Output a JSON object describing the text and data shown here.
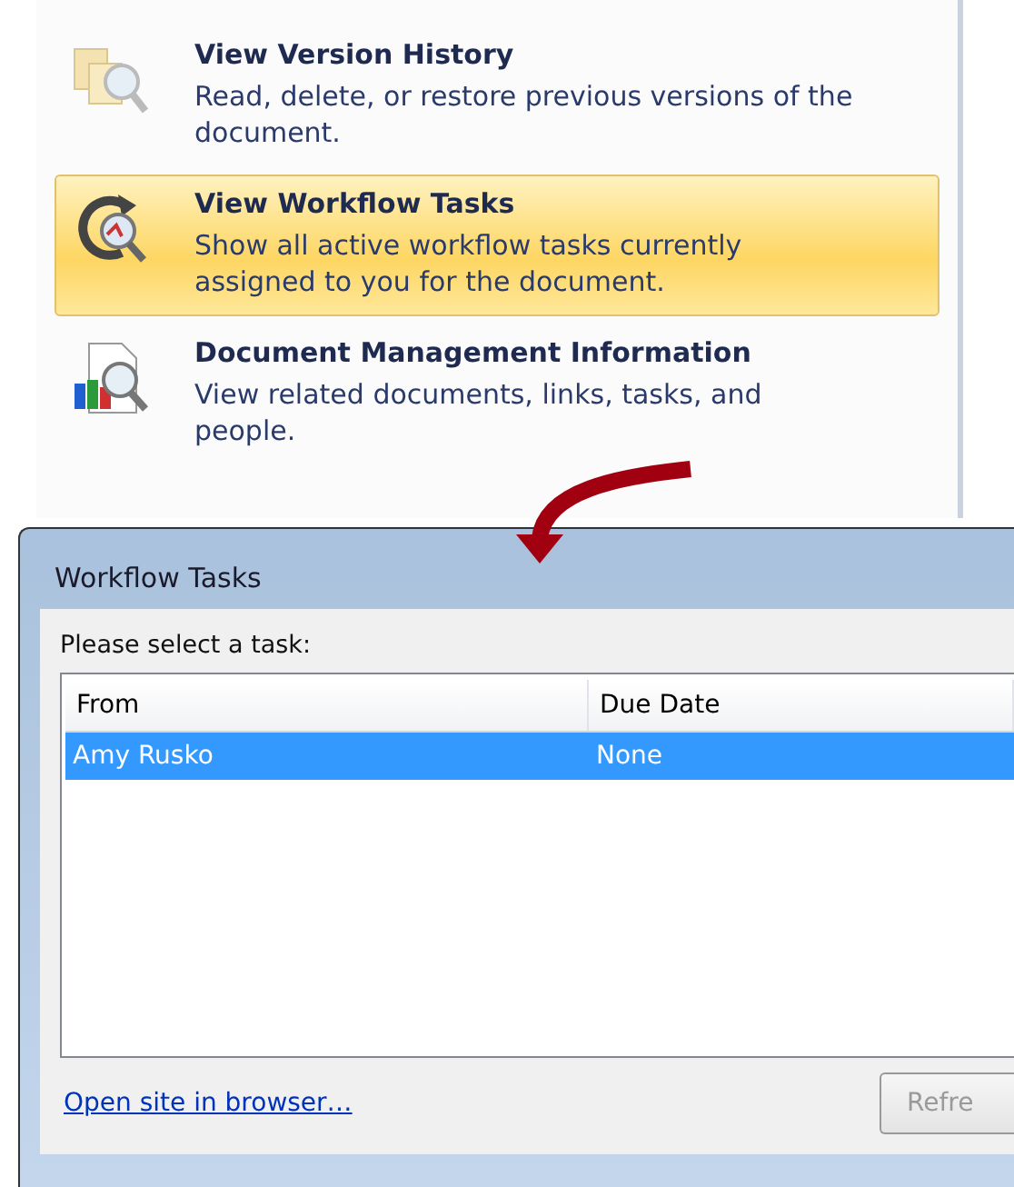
{
  "menu": {
    "items": [
      {
        "kind": "history",
        "title": "View Version History",
        "description": "Read, delete, or restore previous versions of the document.",
        "selected": false
      },
      {
        "kind": "workflow",
        "title": "View Workflow Tasks",
        "description": "Show all active workflow tasks currently assigned to you for the document.",
        "selected": true
      },
      {
        "kind": "management",
        "title": "Document Management Information",
        "description": "View related documents, links, tasks, and people.",
        "selected": false
      }
    ]
  },
  "dialog": {
    "title": "Workflow Tasks",
    "prompt": "Please select a task:",
    "table": {
      "columns": [
        "From",
        "Due Date"
      ],
      "rows": [
        {
          "cells": [
            "Amy Rusko",
            "None"
          ],
          "selected": true
        }
      ]
    },
    "link": "Open site in browser…",
    "buttons": [
      {
        "label": "Refre",
        "disabled": true
      }
    ]
  }
}
